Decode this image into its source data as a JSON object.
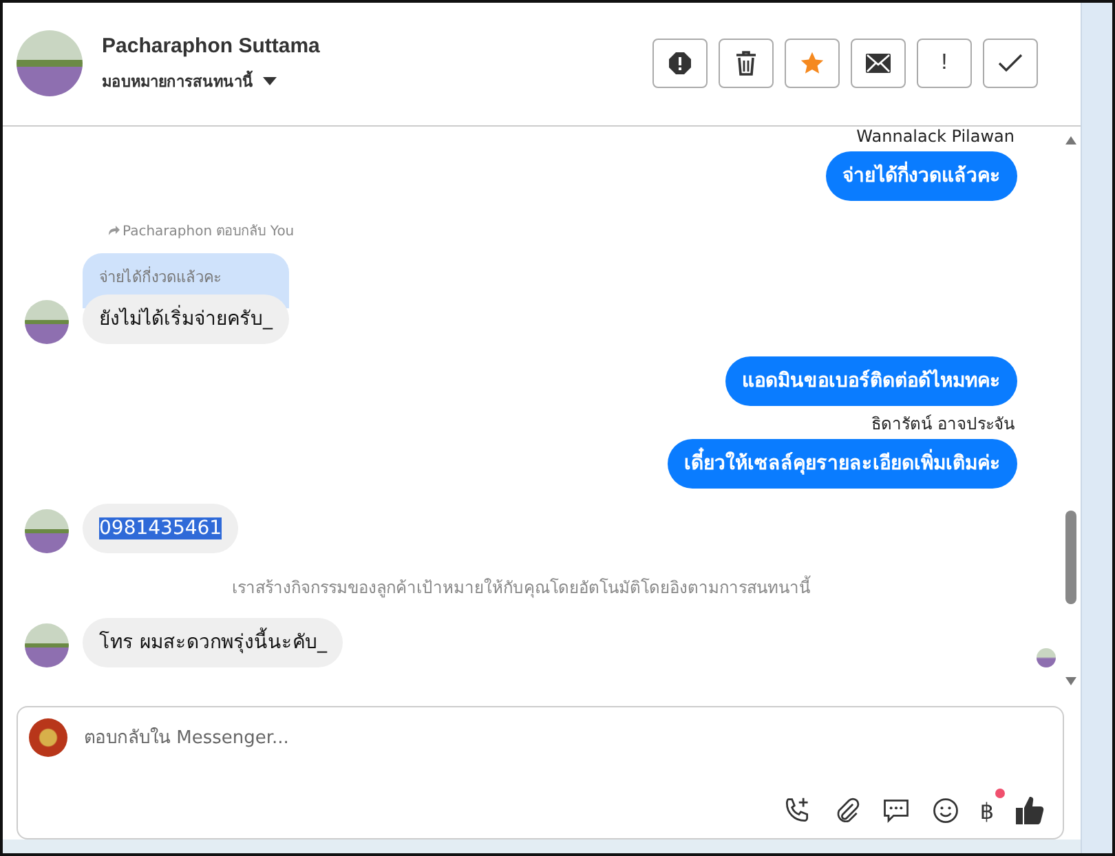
{
  "header": {
    "name": "Pacharaphon Suttama",
    "assign_label": "มอบหมายการสนทนานี้",
    "starred": true,
    "actions": [
      {
        "kind": "alert"
      },
      {
        "kind": "trash"
      },
      {
        "kind": "star"
      },
      {
        "kind": "mail"
      },
      {
        "kind": "text",
        "label": "!"
      },
      {
        "kind": "check"
      }
    ]
  },
  "messages": [
    {
      "kind": "sender_name",
      "text": "Wannalack Pilawan"
    },
    {
      "kind": "outgoing",
      "text": "จ่ายได้กี่งวดแล้วคะ"
    },
    {
      "kind": "reply_note",
      "text": "Pacharaphon ตอบกลับ You"
    },
    {
      "kind": "incoming",
      "quote": "จ่ายได้กี่งวดแล้วคะ",
      "text": "ยังไม่ได้เริ่มจ่ายครับ_",
      "highlighted": false
    },
    {
      "kind": "outgoing",
      "text": "แอดมินขอเบอร์ติดต่อด้ไหมทคะ"
    },
    {
      "kind": "sender_name",
      "text": "ธิดารัตน์ อาจประจัน"
    },
    {
      "kind": "outgoing",
      "text": "เดี๋ยวให้เซลล์คุยรายละเอียดเพิ่มเติมค่ะ"
    },
    {
      "kind": "incoming",
      "text": "0981435461",
      "highlighted": true
    },
    {
      "kind": "system",
      "text": "เราสร้างกิจกรรมของลูกค้าเป้าหมายให้กับคุณโดยอัตโนมัติโดยอิงตามการสนทนานี้"
    },
    {
      "kind": "incoming",
      "text": "โทร ผมสะดวกพรุ่งนี้นะคับ_",
      "highlighted": false,
      "seen": true
    }
  ],
  "composer": {
    "placeholder": "ตอบกลับใน Messenger...",
    "tools": [
      {
        "kind": "call"
      },
      {
        "kind": "clip"
      },
      {
        "kind": "chat"
      },
      {
        "kind": "smile"
      },
      {
        "kind": "text",
        "label": "฿",
        "notify": true
      },
      {
        "kind": "like"
      }
    ]
  }
}
